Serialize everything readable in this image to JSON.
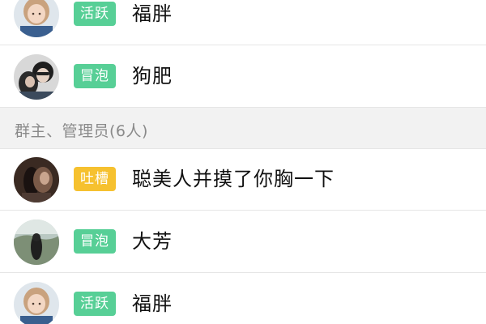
{
  "colors": {
    "badge_green": "#57cf96",
    "badge_yellow": "#f6c12f",
    "section_bg": "#f2f2f2",
    "divider": "#e6e6e6"
  },
  "members_top": [
    {
      "avatar": "girl-portrait-avatar",
      "badge": "活跃",
      "badge_color": "#57cf96",
      "name": "福胖"
    },
    {
      "avatar": "couple-dark-avatar",
      "badge": "冒泡",
      "badge_color": "#57cf96",
      "name": "狗肥"
    }
  ],
  "section": {
    "title": "群主、管理员(6人)"
  },
  "members_admins": [
    {
      "avatar": "dark-portrait-avatar",
      "badge": "吐槽",
      "badge_color": "#f6c12f",
      "name": "聪美人并摸了你胸一下"
    },
    {
      "avatar": "landscape-figure-avatar",
      "badge": "冒泡",
      "badge_color": "#57cf96",
      "name": "大芳"
    },
    {
      "avatar": "girl-portrait-avatar",
      "badge": "活跃",
      "badge_color": "#57cf96",
      "name": "福胖"
    }
  ]
}
